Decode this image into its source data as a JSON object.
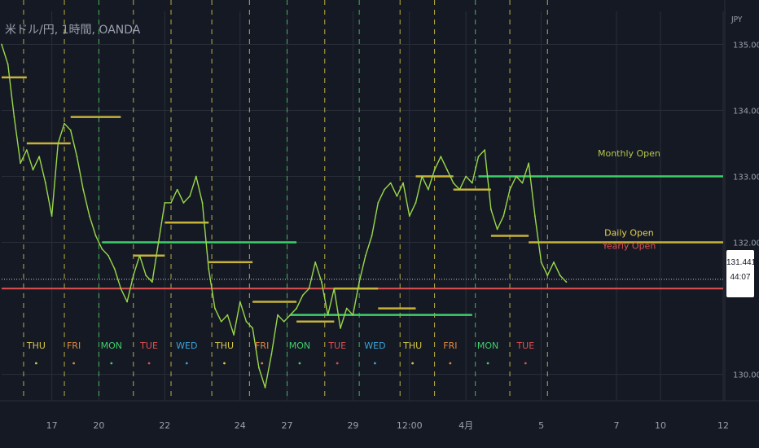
{
  "header": {
    "symbol_title": "米ドル/円, 1時間, OANDA",
    "currency": "JPY"
  },
  "price_badge": {
    "price": "131.441",
    "countdown": "44:07"
  },
  "colors": {
    "background": "#151924",
    "grid": "#2a2e39",
    "price_line": "#9ad84a",
    "daily_open": "#c8b23a",
    "weekly_open": "#3ecf6a",
    "monthly_open": "#b5c64a",
    "yearly_open": "#e05050",
    "day_marker": "#d6c84a",
    "week_marker": "#4bd15a"
  },
  "chart_data": {
    "type": "line",
    "title": "米ドル/円, 1時間, OANDA",
    "xlabel": "",
    "ylabel": "",
    "ylim": [
      129.6,
      135.5
    ],
    "xlim": [
      0,
      115
    ],
    "grid": true,
    "y_ticks": [
      "135.000",
      "134.000",
      "133.000",
      "132.000",
      "130.000"
    ],
    "y_tick_values": [
      135,
      134,
      133,
      132,
      130
    ],
    "x_ticks": [
      {
        "label": "17",
        "x": 8
      },
      {
        "label": "20",
        "x": 15.5
      },
      {
        "label": "22",
        "x": 26
      },
      {
        "label": "24",
        "x": 38
      },
      {
        "label": "27",
        "x": 45.5
      },
      {
        "label": "29",
        "x": 56
      },
      {
        "label": "12:00",
        "x": 65
      },
      {
        "label": "4月",
        "x": 74
      },
      {
        "label": "5",
        "x": 86
      },
      {
        "label": "7",
        "x": 98
      },
      {
        "label": "10",
        "x": 105
      },
      {
        "label": "12",
        "x": 115
      }
    ],
    "vlines_day": [
      3.5,
      10,
      21,
      27,
      33.5,
      39.5,
      51.5,
      63.5,
      69,
      81,
      87
    ],
    "vlines_week": [
      15.5,
      45.5,
      57,
      75.5
    ],
    "series": [
      {
        "points": [
          [
            0,
            135.0
          ],
          [
            1,
            134.7
          ],
          [
            2,
            133.9
          ],
          [
            3,
            133.2
          ],
          [
            4,
            133.4
          ],
          [
            5,
            133.1
          ],
          [
            6,
            133.3
          ],
          [
            7,
            132.9
          ],
          [
            8,
            132.4
          ],
          [
            9,
            133.5
          ],
          [
            10,
            133.8
          ],
          [
            11,
            133.7
          ],
          [
            12,
            133.3
          ],
          [
            13,
            132.8
          ],
          [
            14,
            132.4
          ],
          [
            15,
            132.1
          ],
          [
            16,
            131.9
          ],
          [
            17,
            131.8
          ],
          [
            18,
            131.6
          ],
          [
            19,
            131.3
          ],
          [
            20,
            131.1
          ],
          [
            21,
            131.5
          ],
          [
            22,
            131.8
          ],
          [
            23,
            131.5
          ],
          [
            24,
            131.4
          ],
          [
            25,
            132.0
          ],
          [
            26,
            132.6
          ],
          [
            27,
            132.6
          ],
          [
            28,
            132.8
          ],
          [
            29,
            132.6
          ],
          [
            30,
            132.7
          ],
          [
            31,
            133.0
          ],
          [
            32,
            132.6
          ],
          [
            33,
            131.6
          ],
          [
            34,
            131.0
          ],
          [
            35,
            130.8
          ],
          [
            36,
            130.9
          ],
          [
            37,
            130.6
          ],
          [
            38,
            131.1
          ],
          [
            39,
            130.8
          ],
          [
            40,
            130.7
          ],
          [
            41,
            130.1
          ],
          [
            42,
            129.8
          ],
          [
            43,
            130.3
          ],
          [
            44,
            130.9
          ],
          [
            45,
            130.8
          ],
          [
            46,
            130.9
          ],
          [
            47,
            131.0
          ],
          [
            48,
            131.2
          ],
          [
            49,
            131.3
          ],
          [
            50,
            131.7
          ],
          [
            51,
            131.4
          ],
          [
            52,
            130.9
          ],
          [
            53,
            131.3
          ],
          [
            54,
            130.7
          ],
          [
            55,
            131.0
          ],
          [
            56,
            130.9
          ],
          [
            57,
            131.4
          ],
          [
            58,
            131.8
          ],
          [
            59,
            132.1
          ],
          [
            60,
            132.6
          ],
          [
            61,
            132.8
          ],
          [
            62,
            132.9
          ],
          [
            63,
            132.7
          ],
          [
            64,
            132.9
          ],
          [
            65,
            132.4
          ],
          [
            66,
            132.6
          ],
          [
            67,
            133.0
          ],
          [
            68,
            132.8
          ],
          [
            69,
            133.1
          ],
          [
            70,
            133.3
          ],
          [
            71,
            133.1
          ],
          [
            72,
            132.9
          ],
          [
            73,
            132.8
          ],
          [
            74,
            133.0
          ],
          [
            75,
            132.9
          ],
          [
            76,
            133.3
          ],
          [
            77,
            133.4
          ],
          [
            78,
            132.5
          ],
          [
            79,
            132.2
          ],
          [
            80,
            132.4
          ],
          [
            81,
            132.8
          ],
          [
            82,
            133.0
          ],
          [
            83,
            132.9
          ],
          [
            84,
            133.2
          ],
          [
            85,
            132.4
          ],
          [
            86,
            131.7
          ],
          [
            87,
            131.5
          ],
          [
            88,
            131.7
          ],
          [
            89,
            131.5
          ],
          [
            90,
            131.4
          ]
        ]
      }
    ],
    "levels": [
      {
        "kind": "daily",
        "segments": [
          [
            0,
            4,
            134.5
          ],
          [
            4,
            11,
            133.5
          ],
          [
            11,
            19,
            133.9
          ],
          [
            21,
            26,
            131.8
          ],
          [
            26,
            33,
            132.3
          ],
          [
            33,
            40,
            131.7
          ],
          [
            40,
            47,
            131.1
          ],
          [
            47,
            53,
            130.8
          ],
          [
            53,
            60,
            131.3
          ],
          [
            60,
            66,
            131.0
          ],
          [
            66,
            72,
            133.0
          ],
          [
            72,
            78,
            132.8
          ],
          [
            78,
            84,
            132.1
          ],
          [
            84,
            115,
            132.0
          ]
        ]
      },
      {
        "kind": "weekly",
        "segments": [
          [
            16,
            47,
            132.0
          ],
          [
            46,
            75,
            130.9
          ],
          [
            76,
            115,
            133.0
          ]
        ]
      }
    ],
    "yearly_open": 131.3,
    "current_price": 131.441,
    "annotations": [
      {
        "text": "Monthly Open",
        "x": 100,
        "y": 133.3,
        "kind": "monthly"
      },
      {
        "text": "Daily Open",
        "x": 100,
        "y": 132.1,
        "kind": "daily"
      },
      {
        "text": "Yearly Open",
        "x": 100,
        "y": 131.9,
        "kind": "yearly"
      }
    ],
    "day_labels": [
      {
        "text": "THU",
        "x": 5.5,
        "color": "#d6c84a"
      },
      {
        "text": "FRI",
        "x": 11.5,
        "color": "#e08a3c"
      },
      {
        "text": "MON",
        "x": 17.5,
        "color": "#3ecf6a"
      },
      {
        "text": "TUE",
        "x": 23.5,
        "color": "#e05050"
      },
      {
        "text": "WED",
        "x": 29.5,
        "color": "#3aa6d8"
      },
      {
        "text": "THU",
        "x": 35.5,
        "color": "#d6c84a"
      },
      {
        "text": "FRI",
        "x": 41.5,
        "color": "#e08a3c"
      },
      {
        "text": "MON",
        "x": 47.5,
        "color": "#3ecf6a"
      },
      {
        "text": "TUE",
        "x": 53.5,
        "color": "#e05050"
      },
      {
        "text": "WED",
        "x": 59.5,
        "color": "#3aa6d8"
      },
      {
        "text": "THU",
        "x": 65.5,
        "color": "#d6c84a"
      },
      {
        "text": "FRI",
        "x": 71.5,
        "color": "#e08a3c"
      },
      {
        "text": "MON",
        "x": 77.5,
        "color": "#3ecf6a"
      },
      {
        "text": "TUE",
        "x": 83.5,
        "color": "#e05050"
      }
    ],
    "legend": "none"
  }
}
